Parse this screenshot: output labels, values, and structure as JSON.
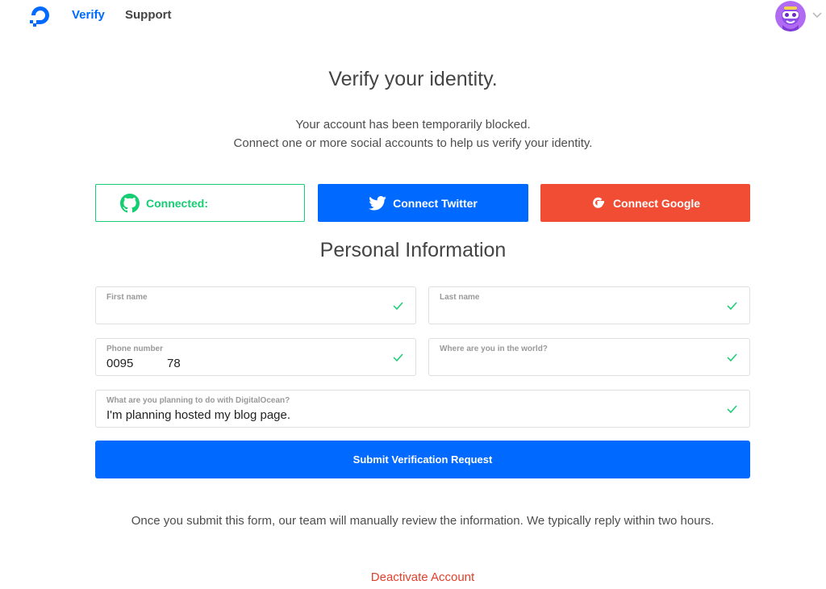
{
  "nav": {
    "logo_icon": "digitalocean-logo-icon",
    "links": {
      "verify": "Verify",
      "support": "Support"
    },
    "avatar_icon": "user-avatar-icon",
    "menu_icon": "chevron-down-icon"
  },
  "header": {
    "title": "Verify your identity.",
    "subtitle_line1": "Your account has been temporarily blocked.",
    "subtitle_line2": "Connect one or more social accounts to help us verify your identity."
  },
  "social": {
    "github": {
      "label": "Connected:",
      "icon": "github-icon",
      "color": "#15cd72"
    },
    "twitter": {
      "label": "Connect Twitter",
      "icon": "twitter-icon",
      "color": "#0069ff"
    },
    "google": {
      "label": "Connect Google",
      "icon": "google-icon",
      "color": "#f04d34"
    }
  },
  "personal": {
    "title": "Personal Information",
    "fields": {
      "first_name": {
        "label": "First name",
        "value": ""
      },
      "last_name": {
        "label": "Last name",
        "value": ""
      },
      "phone": {
        "label": "Phone number",
        "value": "0095          78"
      },
      "location": {
        "label": "Where are you in the world?",
        "value": ""
      },
      "plan": {
        "label": "What are you planning to do with DigitalOcean?",
        "value": "I'm planning hosted my blog page."
      }
    },
    "valid_icon": "check-icon"
  },
  "submit_label": "Submit Verification Request",
  "note": "Once you submit this form, our team will manually review the information. We typically reply within two hours.",
  "deactivate_label": "Deactivate Account",
  "colors": {
    "primary": "#0069ff",
    "success": "#15cd72",
    "danger": "#e0412c"
  }
}
